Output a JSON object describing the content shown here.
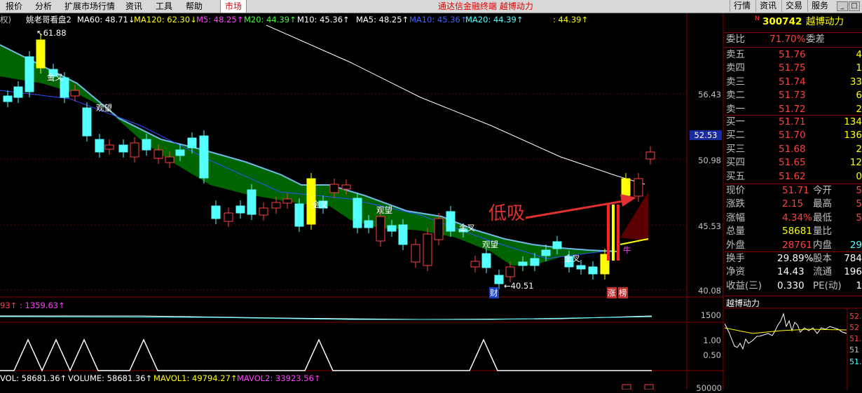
{
  "menubar": {
    "items": [
      "报价",
      "分析",
      "扩展市场行情",
      "资讯",
      "工具",
      "帮助"
    ],
    "market_tab": "市场",
    "center_text": "通达信金融终端  越博动力",
    "right_buttons": [
      "行情",
      "资讯",
      "交易",
      "服务"
    ],
    "window_buttons": [
      "_",
      "□",
      "×"
    ]
  },
  "legend": {
    "prefix": "权)",
    "title": "姚老哥看盘2",
    "ma60": "MA60: 48.71↓",
    "ma120": "MA120: 62.30↓",
    "m5": "M5: 48.25↑",
    "m20": "M20: 44.39↑",
    "m10": "M10: 45.36↑",
    "ma5": "MA5: 48.25↑",
    "ma10": "MA10: 45.36↑",
    "ma20": "MA20: 44.39↑",
    "extra": ": 44.39↑"
  },
  "price_axis": [
    "56.43",
    "52.53",
    "50.98",
    "45.53",
    "40.08"
  ],
  "chart_annotations": {
    "high": "61.88",
    "low": "40.51",
    "cross1": "金叉",
    "watch1": "观望",
    "cross2": "金叉",
    "watch2": "观望",
    "cross3": "金叉",
    "watch3": "观望",
    "cross4": "金叉",
    "big_text": "低吸",
    "cai": "财",
    "zhang": "涨",
    "bang": "榜",
    "niu": "牛"
  },
  "ind1": {
    "label_a": "93↑",
    "label_b": ": 1359.63↑",
    "axis": "1500"
  },
  "ind2": {
    "axis_hi": "1.00",
    "axis_lo": "0.50"
  },
  "ind3": {
    "vol": "VOL: 58681.36↑",
    "volume": "VOLUME: 58681.36↑",
    "mavol1": "MAVOL1: 49794.27↑",
    "mavol2": "MAVOL2: 33923.56↑",
    "axis": "50000"
  },
  "quote": {
    "code": "300742",
    "name": "越博动力",
    "wei_bi_label": "委比",
    "wei_bi": "71.70%",
    "wei_cha_label": "委差",
    "asks": [
      {
        "label": "卖五",
        "price": "51.76",
        "vol": "4"
      },
      {
        "label": "卖四",
        "price": "51.75",
        "vol": "1"
      },
      {
        "label": "卖三",
        "price": "51.74",
        "vol": "33"
      },
      {
        "label": "卖二",
        "price": "51.73",
        "vol": "6"
      },
      {
        "label": "卖一",
        "price": "51.72",
        "vol": "2"
      }
    ],
    "bids": [
      {
        "label": "买一",
        "price": "51.71",
        "vol": "134"
      },
      {
        "label": "买二",
        "price": "51.70",
        "vol": "136"
      },
      {
        "label": "买三",
        "price": "51.68",
        "vol": "2"
      },
      {
        "label": "买四",
        "price": "51.65",
        "vol": "12"
      },
      {
        "label": "买五",
        "price": "51.62",
        "vol": "0"
      }
    ],
    "stats": [
      {
        "l1": "现价",
        "v1": "51.71",
        "l2": "今开",
        "v2": "5"
      },
      {
        "l1": "涨跌",
        "v1": "2.15",
        "l2": "最高",
        "v2": "5"
      },
      {
        "l1": "涨幅",
        "v1": "4.34%",
        "l2": "最低",
        "v2": "5"
      },
      {
        "l1": "总量",
        "v1": "58681",
        "l2": "量比",
        "v2": ""
      },
      {
        "l1": "外盘",
        "v1": "28761",
        "l2": "内盘",
        "v2": "29"
      }
    ],
    "stats2": [
      {
        "l1": "换手",
        "v1": "29.89%",
        "l2": "股本",
        "v2": "784"
      },
      {
        "l1": "净资",
        "v1": "14.43",
        "l2": "流通",
        "v2": "196"
      },
      {
        "l1": "收益(三)",
        "v1": "0.330",
        "l2": "PE(动)",
        "v2": "1"
      }
    ],
    "mini_title": "越博动力",
    "mini_axis": [
      "52.",
      "52",
      "51.",
      "51",
      "51."
    ],
    "current_price_tag": "52.53"
  },
  "colors": {
    "up": "#ff3c3c",
    "down": "#54ffff",
    "yellow": "#ffff00",
    "ma_line": "#ffffff",
    "band": "#006400",
    "band_edge": "#6fb8e8"
  }
}
